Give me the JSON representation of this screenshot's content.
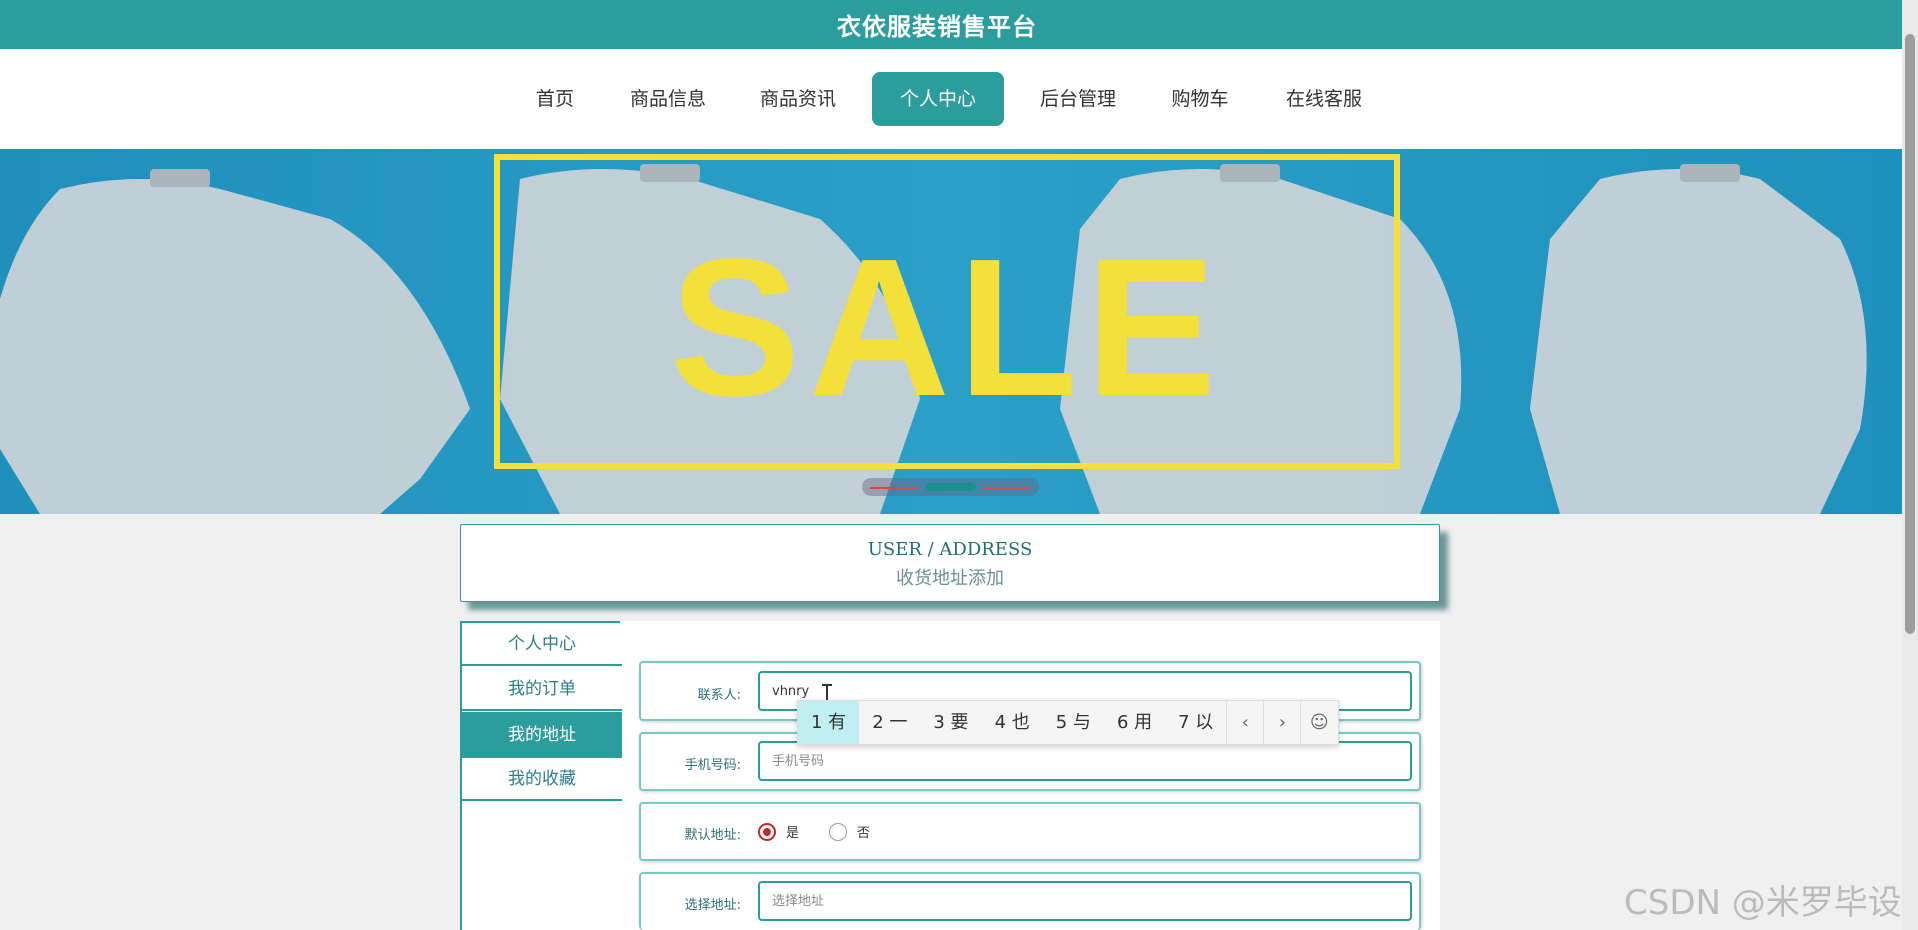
{
  "header": {
    "title": "衣依服装销售平台"
  },
  "nav": {
    "items": [
      {
        "label": "首页"
      },
      {
        "label": "商品信息"
      },
      {
        "label": "商品资讯"
      },
      {
        "label": "个人中心",
        "active": true
      },
      {
        "label": "后台管理"
      },
      {
        "label": "购物车"
      },
      {
        "label": "在线客服"
      }
    ]
  },
  "banner": {
    "sale_text": "SALE"
  },
  "section": {
    "title_en": "USER / ADDRESS",
    "title_cn": "收货地址添加"
  },
  "sidebar": {
    "items": [
      {
        "label": "个人中心"
      },
      {
        "label": "我的订单"
      },
      {
        "label": "我的地址",
        "active": true
      },
      {
        "label": "我的收藏"
      }
    ]
  },
  "form": {
    "contact_label": "联系人:",
    "contact_value": "vhnry",
    "phone_label": "手机号码:",
    "phone_placeholder": "手机号码",
    "default_label": "默认地址:",
    "default_yes": "是",
    "default_no": "否",
    "default_selected": "是",
    "address_label": "选择地址:",
    "address_placeholder": "选择地址"
  },
  "ime": {
    "candidates": [
      "1 有",
      "2 一",
      "3 要",
      "4 也",
      "5 与",
      "6 用",
      "7 以"
    ],
    "prev_icon": "chevron-left-icon",
    "next_icon": "chevron-right-icon",
    "emoji_icon": "smiley-icon"
  },
  "watermark": "CSDN @米罗毕设",
  "colors": {
    "primary": "#2a9d9c",
    "sale_yellow": "#f4e03a",
    "radio_red": "#c62828"
  }
}
